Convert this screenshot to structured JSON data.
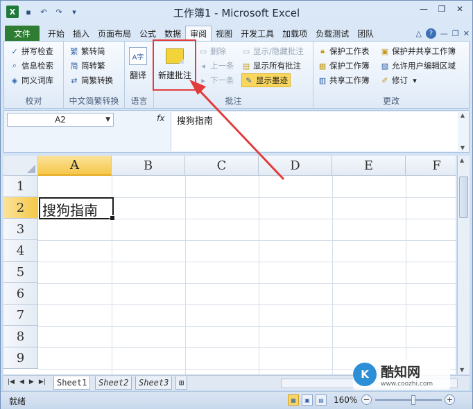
{
  "window": {
    "title": "工作簿1 - Microsoft Excel",
    "logo_letter": "X",
    "qat_icons": [
      "save-icon",
      "undo-icon",
      "redo-icon",
      "customize-icon"
    ]
  },
  "tabs": [
    {
      "label": "文件",
      "name": "tab-file"
    },
    {
      "label": "开始",
      "name": "tab-home"
    },
    {
      "label": "插入",
      "name": "tab-insert"
    },
    {
      "label": "页面布局",
      "name": "tab-page-layout"
    },
    {
      "label": "公式",
      "name": "tab-formulas"
    },
    {
      "label": "数据",
      "name": "tab-data"
    },
    {
      "label": "审阅",
      "name": "tab-review",
      "active": true
    },
    {
      "label": "视图",
      "name": "tab-view"
    },
    {
      "label": "开发工具",
      "name": "tab-developer"
    },
    {
      "label": "加载项",
      "name": "tab-addins"
    },
    {
      "label": "负载测试",
      "name": "tab-load-test"
    },
    {
      "label": "团队",
      "name": "tab-team"
    }
  ],
  "ribbon": {
    "proofing": {
      "label": "校对",
      "spell_check": "拼写检查",
      "research": "信息检索",
      "thesaurus": "同义词库"
    },
    "chinese_conversion": {
      "label": "中文简繁转换",
      "to_simplified": "繁转简",
      "to_traditional": "简转繁",
      "convert": "简繁转换"
    },
    "language": {
      "label": "语言",
      "translate": "翻译"
    },
    "comments": {
      "label": "批注",
      "new_comment": "新建批注",
      "delete": "删除",
      "previous": "上一条",
      "next": "下一条",
      "show_hide": "显示/隐藏批注",
      "show_all": "显示所有批注",
      "show_ink": "显示墨迹"
    },
    "changes": {
      "label": "更改",
      "protect_sheet": "保护工作表",
      "protect_workbook": "保护工作簿",
      "share_workbook": "共享工作簿",
      "protect_share": "保护并共享工作簿",
      "allow_edit_ranges": "允许用户编辑区域",
      "track_changes": "修订"
    }
  },
  "formula_bar": {
    "name_box": "A2",
    "fx": "fx",
    "content": "搜狗指南"
  },
  "grid": {
    "columns": [
      "A",
      "B",
      "C",
      "D",
      "E",
      "F"
    ],
    "rows": [
      "1",
      "2",
      "3",
      "4",
      "5",
      "6",
      "7",
      "8",
      "9"
    ],
    "selected_column": "A",
    "selected_row": "2",
    "active_cell_value": "搜狗指南"
  },
  "sheets": [
    "Sheet1",
    "Sheet2",
    "Sheet3"
  ],
  "status": {
    "ready": "就绪",
    "zoom": "160%"
  },
  "watermark": {
    "logo": "K",
    "name": "酷知网",
    "url": "www.coozhi.com"
  },
  "colors": {
    "file_tab": "#2e7d32",
    "highlight_box": "#e23b3b",
    "selected_header": "#f5c84a"
  }
}
